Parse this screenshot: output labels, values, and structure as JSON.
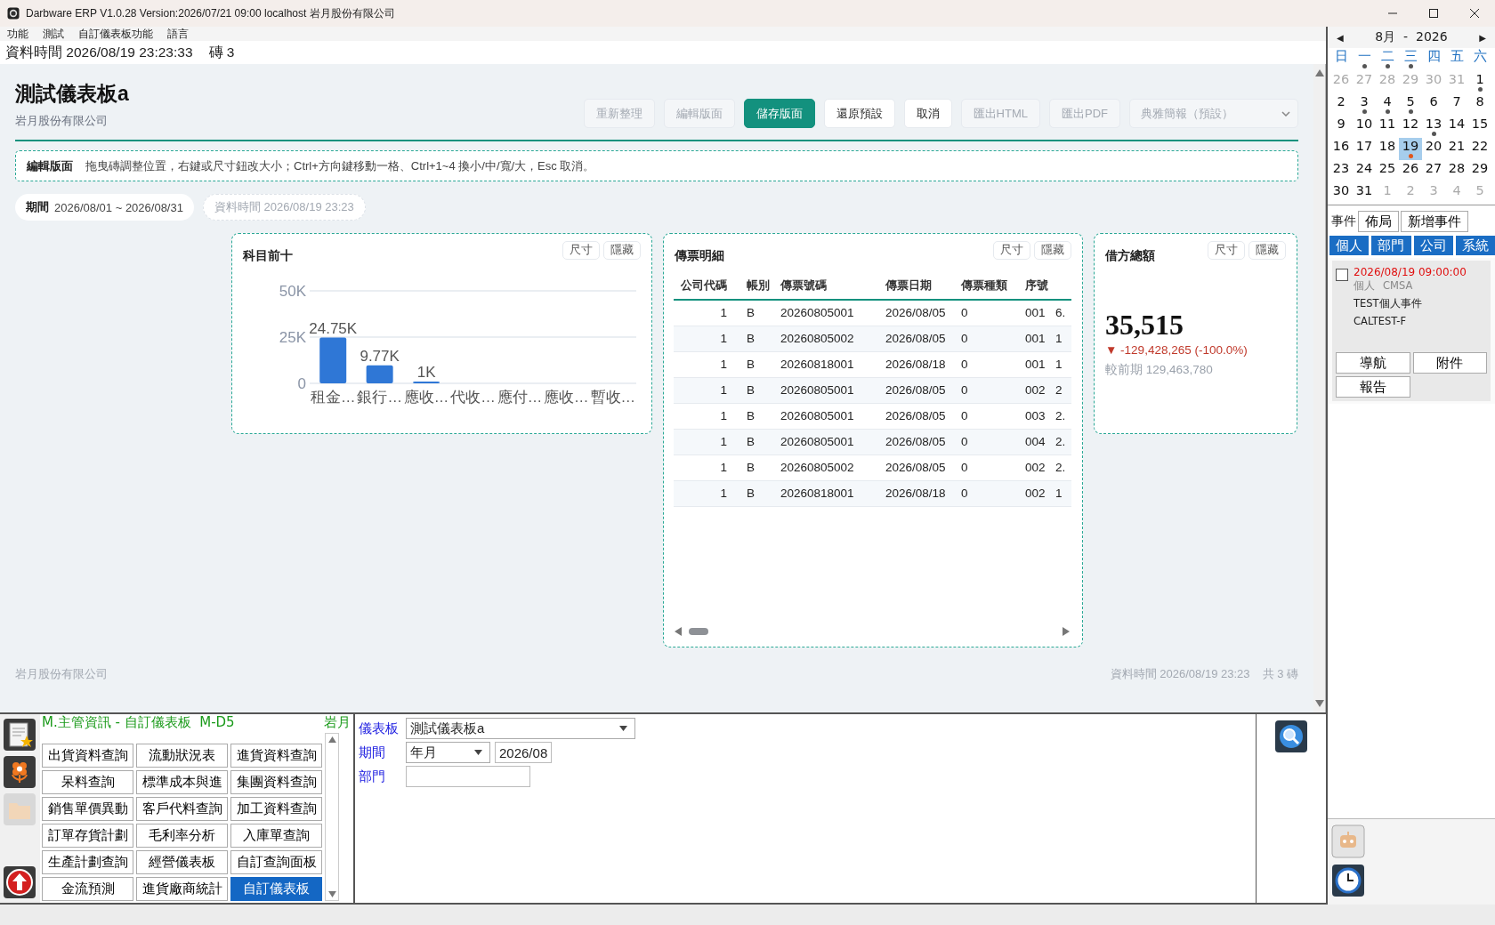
{
  "window": {
    "title": "Darbware ERP V1.0.28 Version:2026/07/21 09:00   localhost 岩月股份有限公司"
  },
  "menu": [
    "功能",
    "測試",
    "自訂儀表板功能",
    "語言"
  ],
  "info_bar": {
    "data_time": "資料時間 2026/08/19 23:23:33",
    "tile_count": "磚 3"
  },
  "dashboard": {
    "title": "測試儀表板a",
    "company": "岩月股份有限公司",
    "toolbar": [
      {
        "label": "重新整理",
        "disabled": true,
        "primary": false
      },
      {
        "label": "編輯版面",
        "disabled": true,
        "primary": false
      },
      {
        "label": "儲存版面",
        "disabled": false,
        "primary": true
      },
      {
        "label": "還原預設",
        "disabled": false,
        "primary": false
      },
      {
        "label": "取消",
        "disabled": false,
        "primary": false
      },
      {
        "label": "匯出HTML",
        "disabled": true,
        "primary": false
      },
      {
        "label": "匯出PDF",
        "disabled": true,
        "primary": false
      }
    ],
    "theme_select": {
      "value": "典雅簡報（預設）",
      "disabled": true
    },
    "edit_banner": {
      "label": "編輯版面",
      "text": "拖曳磚調整位置，右鍵或尺寸鈕改大小；Ctrl+方向鍵移動一格、Ctrl+1~4 換小/中/寬/大，Esc 取消。"
    },
    "chips": [
      {
        "label": "期間",
        "value": "2026/08/01 ~ 2026/08/31",
        "muted": false
      },
      {
        "value": "資料時間 2026/08/19 23:23",
        "muted": true
      }
    ],
    "tiles": [
      {
        "kind": "chart",
        "title": "科目前十",
        "buttons": [
          "尺寸",
          "隱藏"
        ],
        "chart_data": {
          "type": "bar",
          "categories": [
            "租金…",
            "銀行…",
            "應收…",
            "代收…",
            "應付…",
            "應收…",
            "暫收…"
          ],
          "series": [
            {
              "color": "#2f77d6",
              "values": [
                24750,
                9770,
                1000,
                null,
                null,
                null,
                null
              ]
            }
          ],
          "ylim": [
            0,
            50000
          ],
          "yticks": [
            0,
            {
              "value": 25000,
              "label": "25K"
            },
            {
              "value": 50000,
              "label": "50K"
            }
          ],
          "value_labels": [
            "24.75K",
            "9.77K",
            "1K",
            null,
            null,
            null,
            null
          ]
        }
      },
      {
        "kind": "table",
        "title": "傳票明細",
        "buttons": [
          "尺寸",
          "隱藏"
        ],
        "columns": [
          "公司代碼",
          "帳別",
          "傳票號碼",
          "傳票日期",
          "傳票種類",
          "序號"
        ],
        "rows": [
          [
            "1",
            "B",
            "20260805001",
            "2026/08/05",
            "0",
            "001",
            "6."
          ],
          [
            "1",
            "B",
            "20260805002",
            "2026/08/05",
            "0",
            "001",
            "1"
          ],
          [
            "1",
            "B",
            "20260818001",
            "2026/08/18",
            "0",
            "001",
            "1"
          ],
          [
            "1",
            "B",
            "20260805001",
            "2026/08/05",
            "0",
            "002",
            "2"
          ],
          [
            "1",
            "B",
            "20260805001",
            "2026/08/05",
            "0",
            "003",
            "2."
          ],
          [
            "1",
            "B",
            "20260805001",
            "2026/08/05",
            "0",
            "004",
            "2."
          ],
          [
            "1",
            "B",
            "20260805002",
            "2026/08/05",
            "0",
            "002",
            "2."
          ],
          [
            "1",
            "B",
            "20260818001",
            "2026/08/18",
            "0",
            "002",
            "1"
          ]
        ]
      },
      {
        "kind": "kpi",
        "title": "借方總額",
        "buttons": [
          "尺寸",
          "隱藏"
        ],
        "value": "35,515",
        "delta": "▼ -129,428,265 (-100.0%)",
        "previous": "較前期 129,463,780"
      }
    ],
    "footer": {
      "company": "岩月股份有限公司",
      "data_time": "資料時間 2026/08/19 23:23",
      "tile_count": "共 3 磚"
    }
  },
  "calendar": {
    "month": "8月  -  2026",
    "prev": "◀",
    "next": "▶",
    "weekdays": [
      {
        "label": "日",
        "dot": false
      },
      {
        "label": "一",
        "dot": true
      },
      {
        "label": "二",
        "dot": true
      },
      {
        "label": "三",
        "dot": true
      },
      {
        "label": "四",
        "dot": false
      },
      {
        "label": "五",
        "dot": false
      },
      {
        "label": "六",
        "dot": false
      }
    ],
    "days": [
      {
        "label": "26",
        "muted": true,
        "dot": false,
        "selected": false
      },
      {
        "label": "27",
        "muted": true,
        "dot": false,
        "selected": false
      },
      {
        "label": "28",
        "muted": true,
        "dot": false,
        "selected": false
      },
      {
        "label": "29",
        "muted": true,
        "dot": false,
        "selected": false
      },
      {
        "label": "30",
        "muted": true,
        "dot": false,
        "selected": false
      },
      {
        "label": "31",
        "muted": true,
        "dot": false,
        "selected": false
      },
      {
        "label": "1",
        "muted": false,
        "dot": true,
        "selected": false
      },
      {
        "label": "2",
        "muted": false,
        "dot": false,
        "selected": false
      },
      {
        "label": "3",
        "muted": false,
        "dot": true,
        "selected": false
      },
      {
        "label": "4",
        "muted": false,
        "dot": true,
        "selected": false
      },
      {
        "label": "5",
        "muted": false,
        "dot": true,
        "selected": false
      },
      {
        "label": "6",
        "muted": false,
        "dot": false,
        "selected": false
      },
      {
        "label": "7",
        "muted": false,
        "dot": false,
        "selected": false
      },
      {
        "label": "8",
        "muted": false,
        "dot": false,
        "selected": false
      },
      {
        "label": "9",
        "muted": false,
        "dot": false,
        "selected": false
      },
      {
        "label": "10",
        "muted": false,
        "dot": false,
        "selected": false
      },
      {
        "label": "11",
        "muted": false,
        "dot": false,
        "selected": false
      },
      {
        "label": "12",
        "muted": false,
        "dot": false,
        "selected": false
      },
      {
        "label": "13",
        "muted": false,
        "dot": true,
        "selected": false
      },
      {
        "label": "14",
        "muted": false,
        "dot": false,
        "selected": false
      },
      {
        "label": "15",
        "muted": false,
        "dot": false,
        "selected": false
      },
      {
        "label": "16",
        "muted": false,
        "dot": false,
        "selected": false
      },
      {
        "label": "17",
        "muted": false,
        "dot": false,
        "selected": false
      },
      {
        "label": "18",
        "muted": false,
        "dot": false,
        "selected": false
      },
      {
        "label": "19",
        "muted": false,
        "dot": true,
        "selected": true
      },
      {
        "label": "20",
        "muted": false,
        "dot": false,
        "selected": false
      },
      {
        "label": "21",
        "muted": false,
        "dot": false,
        "selected": false
      },
      {
        "label": "22",
        "muted": false,
        "dot": false,
        "selected": false
      },
      {
        "label": "23",
        "muted": false,
        "dot": false,
        "selected": false
      },
      {
        "label": "24",
        "muted": false,
        "dot": false,
        "selected": false
      },
      {
        "label": "25",
        "muted": false,
        "dot": false,
        "selected": false
      },
      {
        "label": "26",
        "muted": false,
        "dot": false,
        "selected": false
      },
      {
        "label": "27",
        "muted": false,
        "dot": false,
        "selected": false
      },
      {
        "label": "28",
        "muted": false,
        "dot": false,
        "selected": false
      },
      {
        "label": "29",
        "muted": false,
        "dot": false,
        "selected": false
      },
      {
        "label": "30",
        "muted": false,
        "dot": false,
        "selected": false
      },
      {
        "label": "31",
        "muted": false,
        "dot": false,
        "selected": false
      },
      {
        "label": "1",
        "muted": true,
        "dot": false,
        "selected": false
      },
      {
        "label": "2",
        "muted": true,
        "dot": false,
        "selected": false
      },
      {
        "label": "3",
        "muted": true,
        "dot": false,
        "selected": false
      },
      {
        "label": "4",
        "muted": true,
        "dot": false,
        "selected": false
      },
      {
        "label": "5",
        "muted": true,
        "dot": false,
        "selected": false
      }
    ],
    "events_label": "事件",
    "buttons": [
      "佈局",
      "新增事件"
    ],
    "tabs": [
      "個人",
      "部門",
      "公司",
      "系統"
    ],
    "events": [
      {
        "checked": false,
        "time": "2026/08/19 09:00:00",
        "category": "個人",
        "owner": "CMSA",
        "title": "TEST個人事件",
        "code": "CALTEST-F"
      }
    ],
    "event_buttons": [
      "導航",
      "附件",
      "報告"
    ]
  },
  "module_panel": {
    "title": "M.主管資訊 - 自訂儀表板  M-D5",
    "company": "岩月",
    "functions": [
      {
        "label": "出貨資料查詢",
        "selected": false
      },
      {
        "label": "流動狀況表",
        "selected": false
      },
      {
        "label": "進貨資料查詢",
        "selected": false
      },
      {
        "label": "呆料查詢",
        "selected": false
      },
      {
        "label": "標準成本與進",
        "selected": false
      },
      {
        "label": "集團資料查詢",
        "selected": false
      },
      {
        "label": "銷售單價異動",
        "selected": false
      },
      {
        "label": "客戶代料查詢",
        "selected": false
      },
      {
        "label": "加工資料查詢",
        "selected": false
      },
      {
        "label": "訂單存貨計劃",
        "selected": false
      },
      {
        "label": "毛利率分析",
        "selected": false
      },
      {
        "label": "入庫單查詢",
        "selected": false
      },
      {
        "label": "生產計劃查詢",
        "selected": false
      },
      {
        "label": "經營儀表板",
        "selected": false
      },
      {
        "label": "自訂查詢面板",
        "selected": false
      },
      {
        "label": "金流預測",
        "selected": false
      },
      {
        "label": "進貨廠商統計",
        "selected": false
      },
      {
        "label": "自訂儀表板",
        "selected": true
      }
    ],
    "form": [
      {
        "label": "儀表板",
        "kind": "combo",
        "value": "測試儀表板a"
      },
      {
        "label": "期間",
        "kind": "period",
        "value": "年月",
        "extra": "2026/08"
      },
      {
        "label": "部門",
        "kind": "text"
      }
    ]
  }
}
